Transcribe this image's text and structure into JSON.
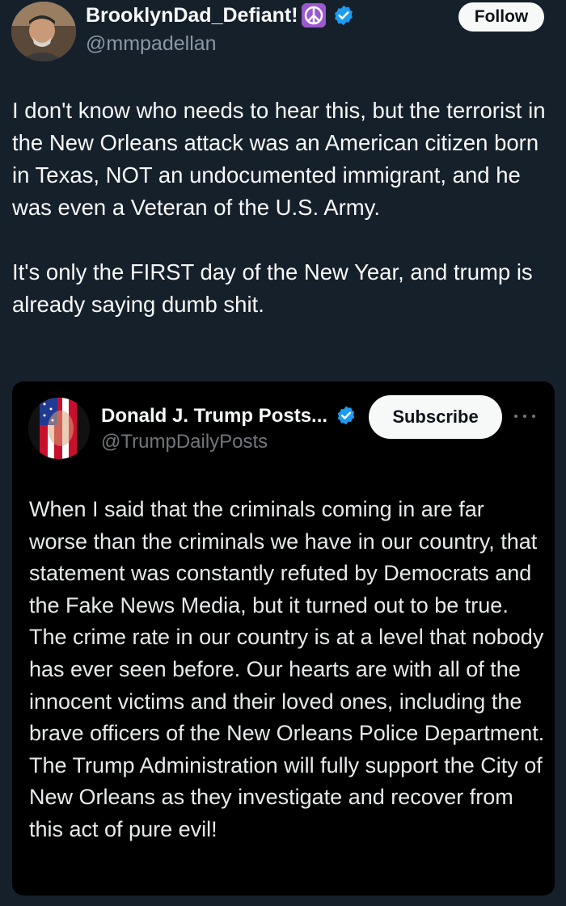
{
  "author": {
    "name": "BrooklynDad_Defiant!",
    "emoji": "☮",
    "handle": "@mmpadellan",
    "follow_label": "Follow"
  },
  "tweet": {
    "paragraphs": [
      "I don't know who needs to hear this, but the terrorist in the New Orleans attack was an American citizen born in Texas, NOT an undocumented immigrant, and he was even a Veteran of the U.S. Army.",
      "It's only the FIRST day of the New Year, and trump is already saying dumb shit."
    ]
  },
  "quoted": {
    "name": "Donald J. Trump Posts...",
    "handle": "@TrumpDailyPosts",
    "subscribe_label": "Subscribe",
    "text": "When I said that the criminals coming in are far worse than the criminals we have in our country, that statement was constantly refuted by Democrats and the Fake News Media, but it turned out to be true. The crime rate in our country is at a level that nobody has ever seen before. Our hearts are with all of the innocent victims and their loved ones, including the brave officers of the New Orleans Police Department. The Trump Administration will fully support the City of New Orleans as they investigate and recover from this act of pure evil!"
  },
  "colors": {
    "background": "#15202b",
    "card_background": "#000000",
    "verified_blue": "#1d9bf0",
    "secondary_text": "#8b98a5"
  },
  "icons": {
    "verified": "verified-badge-icon",
    "more": "more-options-icon",
    "peace": "peace-symbol-icon"
  }
}
